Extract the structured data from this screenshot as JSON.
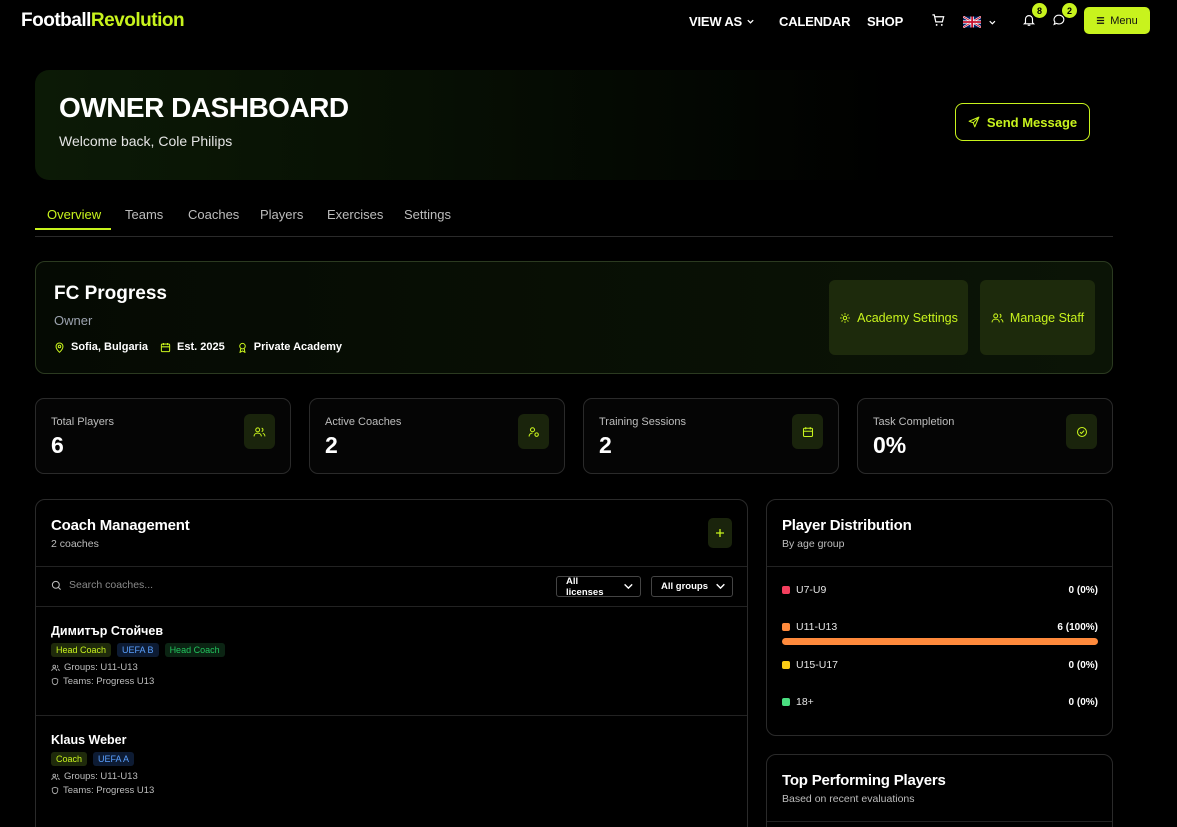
{
  "brand": {
    "part1": "Football",
    "part2": "Revolution",
    "accent": "#c8f31d"
  },
  "nav": {
    "view_as": "VIEW AS",
    "calendar": "CALENDAR",
    "shop": "SHOP",
    "notifications_count": "8",
    "messages_count": "2",
    "menu_label": "Menu"
  },
  "hero": {
    "title": "OWNER DASHBOARD",
    "welcome": "Welcome back, Cole Philips",
    "send_message": "Send Message"
  },
  "tabs": [
    {
      "label": "Overview",
      "active": true
    },
    {
      "label": "Teams"
    },
    {
      "label": "Coaches"
    },
    {
      "label": "Players"
    },
    {
      "label": "Exercises"
    },
    {
      "label": "Settings"
    }
  ],
  "club": {
    "name": "FC Progress",
    "role": "Owner",
    "location": "Sofia, Bulgaria",
    "established": "Est. 2025",
    "type": "Private Academy",
    "academy_settings": "Academy Settings",
    "manage_staff": "Manage Staff"
  },
  "stats": [
    {
      "label": "Total Players",
      "value": "6",
      "icon": "users-icon"
    },
    {
      "label": "Active Coaches",
      "value": "2",
      "icon": "coach-icon"
    },
    {
      "label": "Training Sessions",
      "value": "2",
      "icon": "calendar-icon"
    },
    {
      "label": "Task Completion",
      "value": "0%",
      "icon": "check-circle-icon"
    }
  ],
  "coach_management": {
    "title": "Coach Management",
    "subtitle": "2 coaches",
    "search_placeholder": "Search coaches...",
    "license_filter": "All licenses",
    "group_filter": "All groups",
    "coaches": [
      {
        "name": "Димитър Стойчев",
        "chips": [
          {
            "text": "Head Coach",
            "style": "lime"
          },
          {
            "text": "UEFA B",
            "style": "blue"
          },
          {
            "text": "Head Coach",
            "style": "green"
          }
        ],
        "groups": "Groups: U11-U13",
        "teams": "Teams: Progress U13"
      },
      {
        "name": "Klaus Weber",
        "chips": [
          {
            "text": "Coach",
            "style": "lime"
          },
          {
            "text": "UEFA A",
            "style": "blue"
          }
        ],
        "groups": "Groups: U11-U13",
        "teams": "Teams: Progress U13"
      }
    ]
  },
  "distribution": {
    "title": "Player Distribution",
    "subtitle": "By age group",
    "rows": [
      {
        "label": "U7-U9",
        "value": "0 (0%)",
        "color": "#f43f5e",
        "fraction": 0
      },
      {
        "label": "U11-U13",
        "value": "6 (100%)",
        "color": "#ff8a3c",
        "fraction": 1
      },
      {
        "label": "U15-U17",
        "value": "0 (0%)",
        "color": "#facc15",
        "fraction": 0
      },
      {
        "label": "18+",
        "value": "0 (0%)",
        "color": "#4ade80",
        "fraction": 0
      }
    ]
  },
  "top_players": {
    "title": "Top Performing Players",
    "subtitle": "Based on recent evaluations"
  }
}
